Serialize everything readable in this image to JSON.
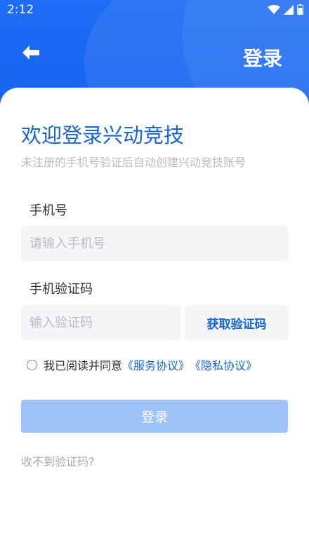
{
  "status_bar": {
    "time": "2:12"
  },
  "header": {
    "title": "登录"
  },
  "welcome": {
    "title": "欢迎登录兴动竞技",
    "subtitle": "未注册的手机号验证后自动创建兴动竞技账号"
  },
  "form": {
    "phone_label": "手机号",
    "phone_placeholder": "请输入手机号",
    "code_label": "手机验证码",
    "code_placeholder": "输入验证码",
    "get_code_label": "获取验证码"
  },
  "agreement": {
    "prefix": "我已阅读并同意",
    "service_link": "《服务协议》",
    "privacy_link": "《隐私协议》"
  },
  "login_button": "登录",
  "no_code_link": "收不到验证码?",
  "colors": {
    "primary": "#1565d8",
    "header": "#1f6cf5",
    "button_disabled": "#9cc2f7"
  }
}
